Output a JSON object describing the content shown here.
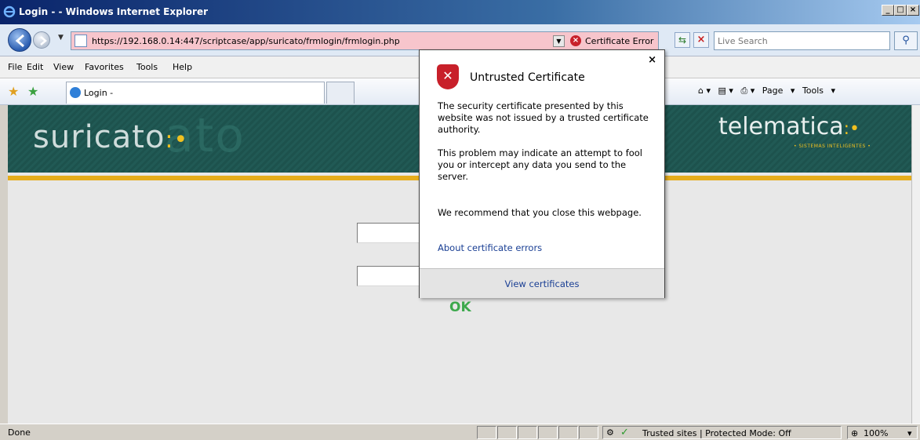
{
  "window": {
    "title": "Login - - Windows Internet Explorer",
    "minimize": "_",
    "maximize": "□",
    "close": "×"
  },
  "address_bar": {
    "url": "https://192.168.0.14:447/scriptcase/app/suricato/frmlogin/frmlogin.php",
    "cert_error_label": "Certificate Error",
    "background_color": "#f7c5cc"
  },
  "search": {
    "placeholder": "Live Search"
  },
  "menu": [
    "File",
    "Edit",
    "View",
    "Favorites",
    "Tools",
    "Help"
  ],
  "tab": {
    "label": "Login -"
  },
  "command_bar": {
    "page_label": "Page",
    "tools_label": "Tools"
  },
  "page": {
    "banner_logo": "suricato",
    "banner_ghost": "ato",
    "banner_right": "telematica",
    "banner_right_sub": "• SISTEMAS INTELIGENTES •",
    "ok_label": "OK",
    "accent_color": "#e6ad1c",
    "ok_color": "#3da94d"
  },
  "cert_popup": {
    "title": "Untrusted Certificate",
    "p1": "The security certificate presented by this website was not issued by a trusted certificate authority.",
    "p2": "This problem may indicate an attempt to fool you or intercept any data you send to the server.",
    "p3": "We recommend that you close this webpage.",
    "link": "About certificate errors",
    "footer_link": "View certificates",
    "close": "×",
    "icon": "shield-error-icon"
  },
  "status": {
    "text": "Done",
    "zone": "Trusted sites | Protected Mode: Off",
    "zoom": "100%"
  }
}
